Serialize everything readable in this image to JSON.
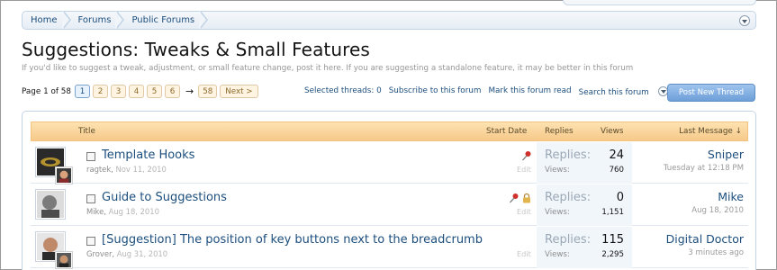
{
  "breadcrumb": [
    "Home",
    "Forums",
    "Public Forums"
  ],
  "forum": {
    "title": "Suggestions: Tweaks & Small Features",
    "description": "If you'd like to suggest a tweak, adjustment, or small feature change, post it here. If you are suggesting a standalone feature, it may be better in this forum"
  },
  "pagination": {
    "label": "Page 1 of 58",
    "pages": [
      "1",
      "2",
      "3",
      "4",
      "5",
      "6"
    ],
    "current": "1",
    "arrow": "→",
    "last": "58",
    "next": "Next >"
  },
  "toolbar": {
    "selected": "Selected threads: 0",
    "subscribe": "Subscribe to this forum",
    "mark_read": "Mark this forum read",
    "search": "Search this forum",
    "post_new": "Post New Thread"
  },
  "table": {
    "headers": {
      "title": "Title",
      "start_date": "Start Date",
      "replies": "Replies",
      "views": "Views",
      "last_message": "Last Message ↓"
    },
    "replies_label": "Replies:",
    "views_label": "Views:",
    "edit_label": "Edit",
    "rows": [
      {
        "title": "Template Hooks",
        "author": "ragtek,",
        "date": "Nov 11, 2010",
        "replies": "24",
        "views": "760",
        "last_user": "Sniper",
        "last_date": "Tuesday at 12:18 PM",
        "sticky": true,
        "locked": false
      },
      {
        "title": "Guide to Suggestions",
        "author": "Mike,",
        "date": "Aug 18, 2010",
        "replies": "0",
        "views": "1,151",
        "last_user": "Mike",
        "last_date": "Aug 18, 2010",
        "sticky": true,
        "locked": true
      },
      {
        "title": "[Suggestion] The position of key buttons next to the breadcrumb",
        "author": "Grover,",
        "date": "Aug 31, 2010",
        "replies": "115",
        "views": "2,295",
        "last_user": "Digital Doctor",
        "last_date": "3 minutes ago",
        "sticky": false,
        "locked": false
      }
    ]
  },
  "colors": {
    "link": "#1c4e7d",
    "header_bg": "#f6c98a",
    "stats_bg": "#f1f6fb",
    "button": "#6d9fd8"
  },
  "icons": [
    "sticky-pin-icon",
    "lock-icon",
    "chevron-down-icon"
  ]
}
